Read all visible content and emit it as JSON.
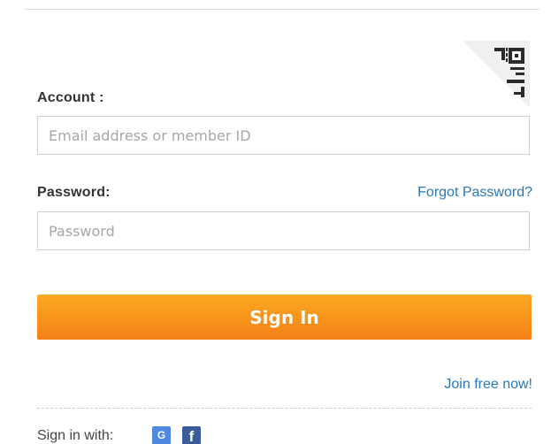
{
  "account": {
    "label": "Account :",
    "placeholder": "Email address or member ID",
    "value": ""
  },
  "password": {
    "label": "Password:",
    "placeholder": "Password",
    "value": "",
    "forgot_link": "Forgot Password?"
  },
  "signin_button": "Sign In",
  "join_link": "Join free now!",
  "social": {
    "label": "Sign in with:",
    "google_glyph": "G",
    "facebook_glyph": "f",
    "icons": [
      "google-icon",
      "facebook-icon"
    ]
  },
  "qr_icon": "qr-code-icon",
  "colors": {
    "accent": "#f8951b",
    "link": "#2a78b7",
    "google": "#4f88e0",
    "facebook": "#3b5b99"
  }
}
